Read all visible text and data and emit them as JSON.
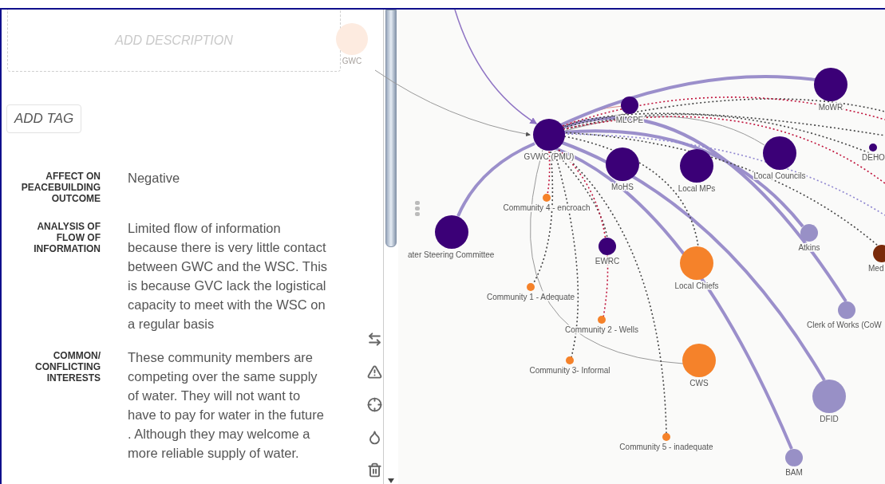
{
  "panel": {
    "description": {
      "placeholder": "ADD DESCRIPTION"
    },
    "tag_button": "ADD TAG",
    "fields": [
      {
        "label": "AFFECT ON PEACEBUILDING OUTCOME",
        "value": "Negative"
      },
      {
        "label": "ANALYSIS OF FLOW OF INFORMATION",
        "value": "Limited flow of information because there is very little contact between GWC and the WSC. This is because GVC lack the logistical capacity to meet with the WSC on a regular basis"
      },
      {
        "label": "COMMON/ CONFLICTING INTERESTS",
        "value": "These community members are competing over the same supply of water. They will not want to have to pay for water in the future . Although they may welcome a more reliable supply of water."
      }
    ]
  },
  "graph": {
    "nodes": [
      {
        "label": "GWC",
        "color": "#fdebe0",
        "faded": true
      },
      {
        "label": "GVWC (PMU)",
        "color": "#3b0077",
        "faded": false
      },
      {
        "label": "MLCPE",
        "color": "#3b0077",
        "faded": false
      },
      {
        "label": "MoWR",
        "color": "#3b0077",
        "faded": false
      },
      {
        "label": "DEHO",
        "color": "#3b0077",
        "faded": false
      },
      {
        "label": "Local Councils",
        "color": "#3b0077",
        "faded": false
      },
      {
        "label": "MoHS",
        "color": "#3b0077",
        "faded": false
      },
      {
        "label": "Local MPs",
        "color": "#3b0077",
        "faded": false
      },
      {
        "label": "Community 4 - encroach",
        "color": "#f5822a",
        "faded": false
      },
      {
        "label": "ater Steering Committee",
        "color": "#3b0077",
        "faded": false
      },
      {
        "label": "Atkins",
        "color": "#9890c6",
        "faded": false
      },
      {
        "label": "Med",
        "color": "#7a2a0a",
        "faded": false
      },
      {
        "label": "EWRC",
        "color": "#3b0077",
        "faded": false
      },
      {
        "label": "Local Chiefs",
        "color": "#f5822a",
        "faded": false
      },
      {
        "label": "Community 1 - Adequate",
        "color": "#f5822a",
        "faded": false
      },
      {
        "label": "Community 2 - Wells",
        "color": "#f5822a",
        "faded": false
      },
      {
        "label": "Clerk of Works (CoW",
        "color": "#9890c6",
        "faded": false
      },
      {
        "label": "Community 3- Informal",
        "color": "#f5822a",
        "faded": false
      },
      {
        "label": "CWS",
        "color": "#f5822a",
        "faded": false
      },
      {
        "label": "DFID",
        "color": "#9890c6",
        "faded": false
      },
      {
        "label": "Community 5 - inadequate",
        "color": "#f5822a",
        "faded": false
      },
      {
        "label": "BAM",
        "color": "#9890c6",
        "faded": false
      }
    ]
  }
}
